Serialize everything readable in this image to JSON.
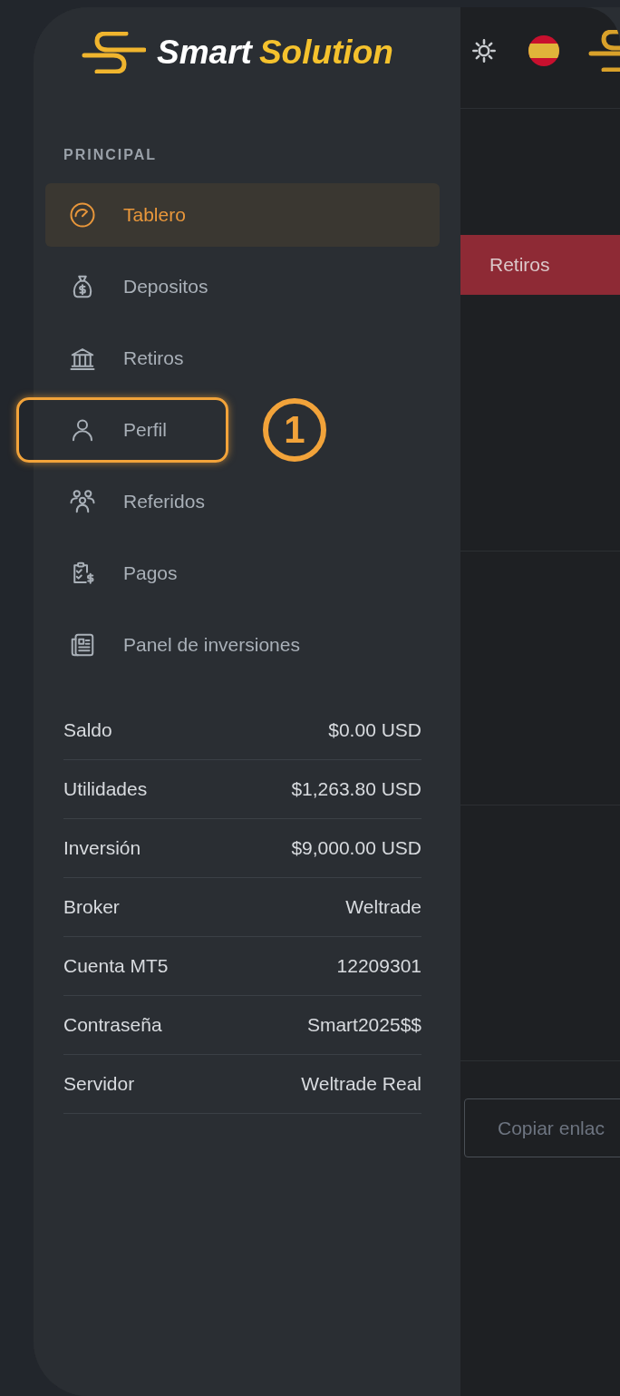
{
  "logo": {
    "word_1": "Smart",
    "word_2": "Solution"
  },
  "sidebar": {
    "section_label": "PRINCIPAL",
    "items": [
      {
        "label": "Tablero",
        "kind": "gauge",
        "selected": true,
        "highlighted": false
      },
      {
        "label": "Depositos",
        "kind": "moneybag",
        "selected": false,
        "highlighted": false
      },
      {
        "label": "Retiros",
        "kind": "bank",
        "selected": false,
        "highlighted": false
      },
      {
        "label": "Perfil",
        "kind": "user",
        "selected": false,
        "highlighted": true
      },
      {
        "label": "Referidos",
        "kind": "group",
        "selected": false,
        "highlighted": false
      },
      {
        "label": "Pagos",
        "kind": "payment",
        "selected": false,
        "highlighted": false
      },
      {
        "label": "Panel de inversiones",
        "kind": "document",
        "selected": false,
        "highlighted": false
      }
    ],
    "account": [
      {
        "label": "Saldo",
        "value": "$0.00 USD"
      },
      {
        "label": "Utilidades",
        "value": "$1,263.80 USD"
      },
      {
        "label": "Inversión",
        "value": "$9,000.00 USD"
      },
      {
        "label": "Broker",
        "value": "Weltrade"
      },
      {
        "label": "Cuenta MT5",
        "value": "12209301"
      },
      {
        "label": "Contraseña",
        "value": "Smart2025$$"
      },
      {
        "label": "Servidor",
        "value": "Weltrade Real"
      }
    ]
  },
  "annotation": {
    "marker": "1"
  },
  "main": {
    "retiros_button": "Retiros",
    "copy_button": "Copiar enlac"
  }
}
